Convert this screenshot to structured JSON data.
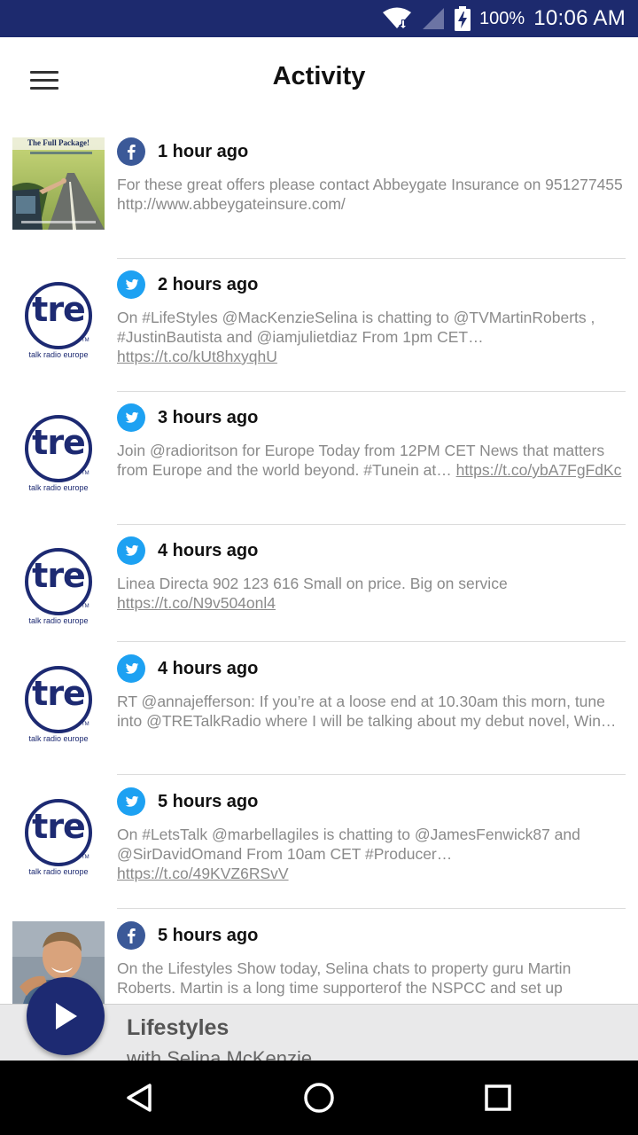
{
  "status_bar": {
    "battery_percent": "100%",
    "time": "10:06 AM",
    "icons": [
      "wifi-icon",
      "signal-icon",
      "battery-charging-icon"
    ]
  },
  "app_bar": {
    "title": "Activity",
    "menu_icon": "hamburger-menu-icon"
  },
  "colors": {
    "status_bar": "#1d2a6e",
    "facebook": "#3b5998",
    "twitter": "#1da1f2",
    "play_button": "#1d2a72",
    "tre_logo": "#1d2a72"
  },
  "thumbnails": {
    "tre_logo_text": "tre",
    "tre_caption": "talk radio europe",
    "tre_tm": "TM",
    "fb_promo_title": "The Full Package!"
  },
  "feed": [
    {
      "source": "facebook",
      "time": "1 hour ago",
      "text": "For these great offers please contact Abbeygate Insurance on 951277455 http://www.abbeygateinsure.com/",
      "link": ""
    },
    {
      "source": "twitter",
      "time": "2 hours ago",
      "text": "On #LifeStyles @MacKenzieSelina is chatting to @TVMartinRoberts , #JustinBautista and @iamjulietdiaz From 1pm CET… ",
      "link": "https://t.co/kUt8hxyqhU"
    },
    {
      "source": "twitter",
      "time": "3 hours ago",
      "text": "Join @radioritson for Europe Today from 12PM CET News that matters from Europe and the world beyond. #Tunein at… ",
      "link": "https://t.co/ybA7FgFdKc"
    },
    {
      "source": "twitter",
      "time": "4 hours ago",
      "text": "Linea Directa 902 123 616 Small on price. Big on service ",
      "link": "https://t.co/N9v504onl4"
    },
    {
      "source": "twitter",
      "time": "4 hours ago",
      "text": "RT @annajefferson: If you’re at a loose end at 10.30am this morn, tune into @TRETalkRadio where I will be talking about my debut novel, Win…",
      "link": ""
    },
    {
      "source": "twitter",
      "time": "5 hours ago",
      "text": "On #LetsTalk @marbellagiles is chatting to @JamesFenwick87 and @SirDavidOmand From 10am CET #Producer… ",
      "link": "https://t.co/49KVZ6RSvV"
    },
    {
      "source": "facebook",
      "time": "5 hours ago",
      "text": "On the Lifestyles Show today, Selina chats to property guru Martin Roberts. Martin is a long time supporterof the NSPCC and set up",
      "link": ""
    }
  ],
  "player": {
    "title": "Lifestyles",
    "subtitle": "with Selina McKenzie",
    "play_icon": "play-icon"
  },
  "nav_bar": {
    "back_icon": "back-icon",
    "home_icon": "home-icon",
    "recents_icon": "recents-icon"
  }
}
